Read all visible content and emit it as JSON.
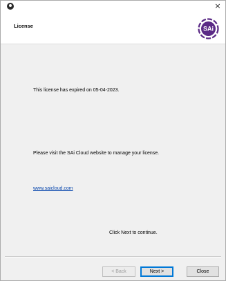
{
  "window": {
    "title_icon": "download-circle-icon",
    "close_glyph": "×"
  },
  "header": {
    "title": "License",
    "logo_text": "SAi",
    "logo_color": "#5b2a86"
  },
  "content": {
    "expired_message": "This license has expired on 05-04-2023.",
    "visit_message": "Please visit the SAi Cloud website to manage your license.",
    "link_text": "www.saicloud.com",
    "next_message": "Click Next to continue."
  },
  "footer": {
    "back_label": "< Back",
    "next_label": "Next >",
    "close_label": "Close"
  },
  "colors": {
    "link": "#0645ad",
    "focus_border": "#0078d7"
  }
}
